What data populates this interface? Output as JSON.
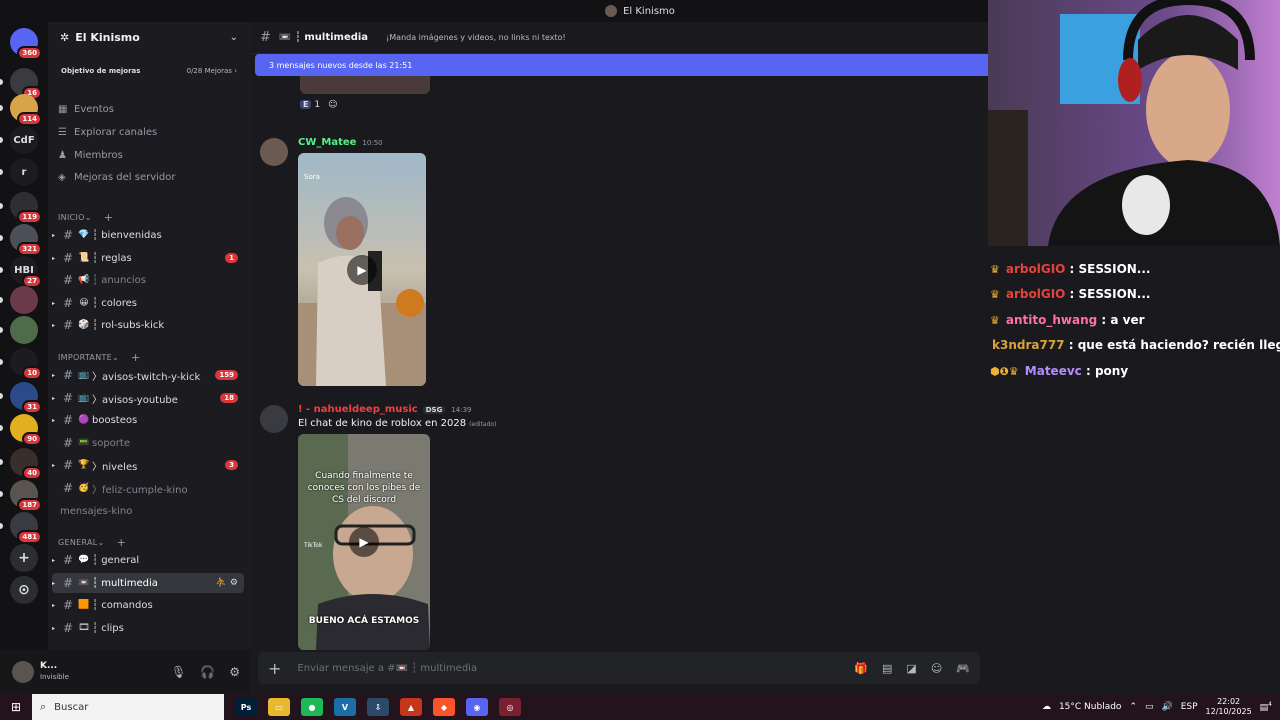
{
  "window": {
    "title": "El Kinismo"
  },
  "rail": {
    "servers": [
      {
        "label": "",
        "badge": "360",
        "color": "#5865f2",
        "icon": "discord-home-icon"
      },
      {
        "label": "",
        "badge": "16",
        "color": "#3a3b40",
        "icon": "server-avatar-icon"
      },
      {
        "label": "",
        "badge": "114",
        "color": "#d8a44a",
        "icon": "server-avatar-icon"
      },
      {
        "label": "CdF",
        "badge": "",
        "color": "#1c1c20",
        "icon": ""
      },
      {
        "label": "r",
        "badge": "",
        "color": "#1c1c20",
        "icon": ""
      },
      {
        "label": "",
        "badge": "119",
        "color": "#2f2f33",
        "icon": "server-avatar-icon"
      },
      {
        "label": "",
        "badge": "321",
        "color": "#4b5058",
        "icon": "server-avatar-icon"
      },
      {
        "label": "HBI",
        "badge": "27",
        "color": "#1c1c20",
        "icon": ""
      },
      {
        "label": "",
        "badge": "",
        "color": "#6b3a4a",
        "icon": "server-avatar-icon"
      },
      {
        "label": "",
        "badge": "",
        "color": "#4e6b4a",
        "icon": "server-avatar-icon"
      },
      {
        "label": "",
        "badge": "10",
        "color": "#1c1c20",
        "icon": "server-avatar-icon"
      },
      {
        "label": "",
        "badge": "31",
        "color": "#2b4a8a",
        "icon": "server-avatar-icon"
      },
      {
        "label": "",
        "badge": "90",
        "color": "#e0b020",
        "icon": "server-avatar-icon"
      },
      {
        "label": "",
        "badge": "40",
        "color": "#3a2e2a",
        "icon": "server-avatar-icon"
      },
      {
        "label": "",
        "badge": "187",
        "color": "#5a5450",
        "icon": "server-avatar-icon"
      },
      {
        "label": "",
        "badge": "481",
        "color": "#3a3b40",
        "icon": "server-avatar-icon"
      }
    ],
    "add_icon": "+",
    "discover_icon": "⊙"
  },
  "server": {
    "name": "El Kinismo",
    "boost_label": "Objetivo de mejoras",
    "boost_progress": "0/28 Mejoras",
    "utilities": [
      "Eventos",
      "Explorar canales",
      "Miembros",
      "Mejoras del servidor"
    ],
    "categories": [
      "INICIO",
      "IMPORTANTE",
      "GENERAL"
    ],
    "channels": [
      {
        "emoji": "💎",
        "name": "┆ bienvenidas",
        "count": "",
        "muted": false
      },
      {
        "emoji": "📜",
        "name": "┆ reglas",
        "count": "1",
        "muted": false
      },
      {
        "emoji": "📢",
        "name": "┆ anuncios",
        "count": "",
        "muted": true
      },
      {
        "emoji": "😀",
        "name": "┆ colores",
        "count": "",
        "muted": false
      },
      {
        "emoji": "🎲",
        "name": "┆ rol-subs-kick",
        "count": "",
        "muted": false
      },
      {
        "emoji": "📺",
        "name": "〉avisos-twitch-y-kick",
        "count": "159",
        "muted": false
      },
      {
        "emoji": "📺",
        "name": "〉avisos-youtube",
        "count": "18",
        "muted": false
      },
      {
        "emoji": "🟣",
        "name": "boosteos",
        "count": "",
        "muted": false
      },
      {
        "emoji": "📟",
        "name": "soporte",
        "count": "",
        "muted": true
      },
      {
        "emoji": "🏆",
        "name": "〉niveles",
        "count": "3",
        "muted": false
      },
      {
        "emoji": "🥳",
        "name": "〉feliz-cumple-kino",
        "count": "",
        "muted": true
      },
      {
        "emoji": "",
        "name": "mensajes-kino",
        "count": "",
        "muted": true
      },
      {
        "emoji": "💬",
        "name": "┆ general",
        "count": "",
        "muted": false
      },
      {
        "emoji": "📼",
        "name": "┆ multimedia",
        "count": "",
        "muted": false
      },
      {
        "emoji": "🟧",
        "name": "┆ comandos",
        "count": "",
        "muted": false
      },
      {
        "emoji": "🎞",
        "name": "┆ clips",
        "count": "",
        "muted": false
      }
    ]
  },
  "user": {
    "name": "K...",
    "status": "Invisible"
  },
  "channel": {
    "name": "┆ multimedia",
    "topic": "¡Manda imágenes y videos, no links ni texto!",
    "new_messages": "3 mensajes nuevos desde las 21:51",
    "reaction_count": "1",
    "reaction_emoji": "E",
    "composer_placeholder": "Enviar mensaje a #📼 ┆ multimedia"
  },
  "messages": [
    {
      "author": "CW_Matee",
      "author_color": "#57f287",
      "time": "10:50",
      "tag": "",
      "text": "",
      "video_label": "Sora",
      "caption": ""
    },
    {
      "author": "! - nahueldeep_music",
      "author_color": "#f23f42",
      "time": "14:39",
      "tag": "DSG",
      "text": "El chat de kino de roblox en 2028",
      "edited": "(editado)",
      "video_label": "TikTok",
      "caption": "Cuando finalmente te conoces con los pibes de CS del discord",
      "bottom_caption": "BUENO ACÁ ESTAMOS"
    }
  ],
  "stream_chat": [
    {
      "badges": "♛",
      "user": "arbolGIO",
      "color": "#e8413c",
      "text": "SESSION..."
    },
    {
      "badges": "♛",
      "user": "arbolGIO",
      "color": "#e8413c",
      "text": "SESSION..."
    },
    {
      "badges": "♛",
      "user": "antito_hwang",
      "color": "#ff6fa9",
      "text": "a ver"
    },
    {
      "badges": "",
      "user": "k3ndra777",
      "color": "#d9a23b",
      "text": "que está haciendo? recién llego"
    },
    {
      "badges": "⬢❶♛",
      "user": "Mateevc",
      "color": "#b48cff",
      "text": "pony"
    }
  ],
  "taskbar": {
    "search": "Buscar",
    "weather": "15°C  Nublado",
    "lang": "ESP",
    "time": "22:02",
    "date": "12/10/2025",
    "notif": "4",
    "apps": [
      {
        "label": "Ps",
        "color": "#001e36"
      },
      {
        "label": "▭",
        "color": "#e8b82e"
      },
      {
        "label": "●",
        "color": "#1db954"
      },
      {
        "label": "V",
        "color": "#1b6fa8"
      },
      {
        "label": "⇩",
        "color": "#2b4a6a"
      },
      {
        "label": "▲",
        "color": "#c8361a"
      },
      {
        "label": "◆",
        "color": "#fb542b"
      },
      {
        "label": "◉",
        "color": "#5865f2"
      },
      {
        "label": "◎",
        "color": "#7a2030"
      }
    ]
  }
}
